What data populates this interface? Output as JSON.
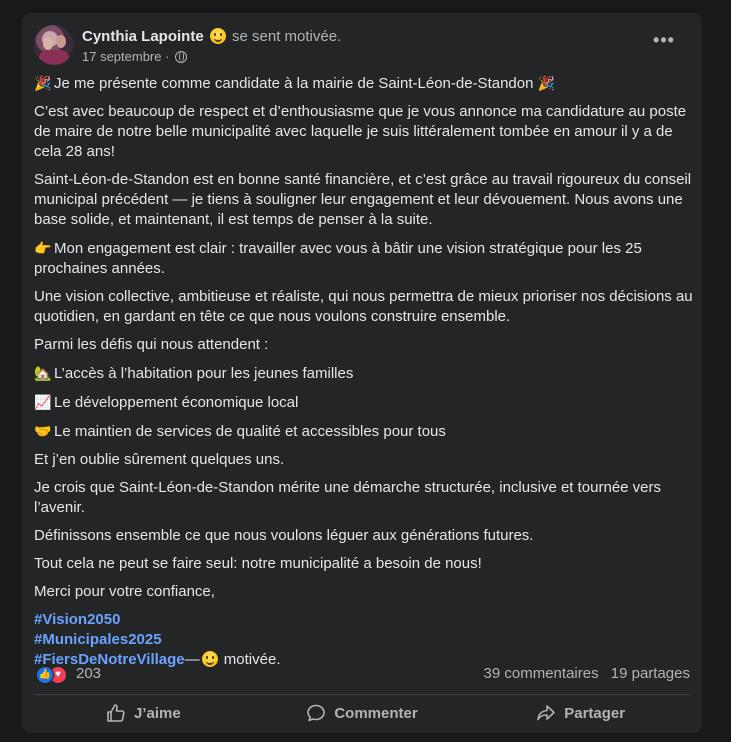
{
  "post": {
    "author": "Cynthia Lapointe",
    "feeling": "se sent motivée.",
    "date": "17 septembre",
    "date_sep": " · ",
    "more_label": "•••",
    "paragraphs": [
      "Je me présente comme candidate à la mairie de Saint-Léon-de-Standon",
      "C’est avec beaucoup de respect et d’enthousiasme que je vous annonce ma candidature au poste de maire de notre belle municipalité avec laquelle je suis littéralement tombée en amour il y a de cela 28 ans!",
      "Saint-Léon-de-Standon est en bonne santé financière, et c’est grâce au travail rigoureux du conseil municipal précédent — je tiens à souligner leur engagement et leur dévouement. Nous avons une base solide, et maintenant, il est temps de penser à la suite.",
      "Mon engagement est clair : travailler avec vous à bâtir une vision stratégique pour les 25 prochaines années.",
      "Une vision collective, ambitieuse et réaliste, qui nous permettra de mieux prioriser nos décisions au quotidien, en gardant en tête ce que nous voulons construire ensemble.",
      "Parmi les défis qui nous attendent :",
      "L’accès à l’habitation pour les jeunes familles",
      "Le développement économique local",
      "Le maintien de services de qualité et accessibles pour tous",
      "Et j’en oublie sûrement quelques uns.",
      "Je crois que Saint-Léon-de-Standon mérite une démarche structurée, inclusive et tournée vers l’avenir.",
      "Définissons ensemble ce que nous voulons léguer aux générations futures.",
      "Tout cela ne peut se faire seul: notre municipalité a besoin de nous!",
      "Merci pour votre confiance,"
    ],
    "icons": {
      "party": "🎉",
      "pointing": "👉",
      "house": "🏡",
      "chart": "📈",
      "handshake": "🤝"
    },
    "hashtags": [
      "#Vision2050",
      "#Municipales2025",
      "#FiersDeNotreVillage"
    ],
    "hashtag_suffix": "—",
    "feeling_tail": "motivée.",
    "reactions_count": "203",
    "comments": "39 commentaires",
    "shares": "19 partages",
    "actions": {
      "like": "J’aime",
      "comment": "Commenter",
      "share": "Partager"
    }
  },
  "colors": {
    "background": "#18191a",
    "card": "#242526",
    "text": "#e4e6eb",
    "secondary": "#b0b3b8",
    "hashtag": "#6aa3ff",
    "like_blue": "#1b74e4",
    "love_red": "#f33e58"
  }
}
